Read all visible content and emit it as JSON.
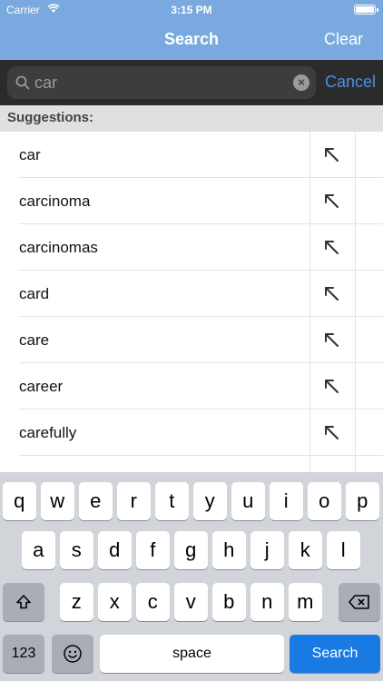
{
  "status_bar": {
    "carrier": "Carrier",
    "time": "3:15 PM"
  },
  "nav": {
    "title": "Search",
    "right_button": "Clear"
  },
  "search": {
    "value": "car",
    "cancel_label": "Cancel"
  },
  "suggestions": {
    "header": "Suggestions:",
    "items": [
      "car",
      "carcinoma",
      "carcinomas",
      "card",
      "care",
      "career",
      "carefully",
      ""
    ]
  },
  "keyboard": {
    "row1": [
      "q",
      "w",
      "e",
      "r",
      "t",
      "y",
      "u",
      "i",
      "o",
      "p"
    ],
    "row2": [
      "a",
      "s",
      "d",
      "f",
      "g",
      "h",
      "j",
      "k",
      "l"
    ],
    "row3": [
      "z",
      "x",
      "c",
      "v",
      "b",
      "n",
      "m"
    ],
    "numbers_label": "123",
    "space_label": "space",
    "search_label": "Search",
    "icons": {
      "shift": "shift-icon",
      "delete": "backspace-icon",
      "emoji": "emoji-icon"
    }
  },
  "colors": {
    "nav": "#7aa9df",
    "accent": "#4a90e2",
    "search_key": "#1a7ae4"
  }
}
